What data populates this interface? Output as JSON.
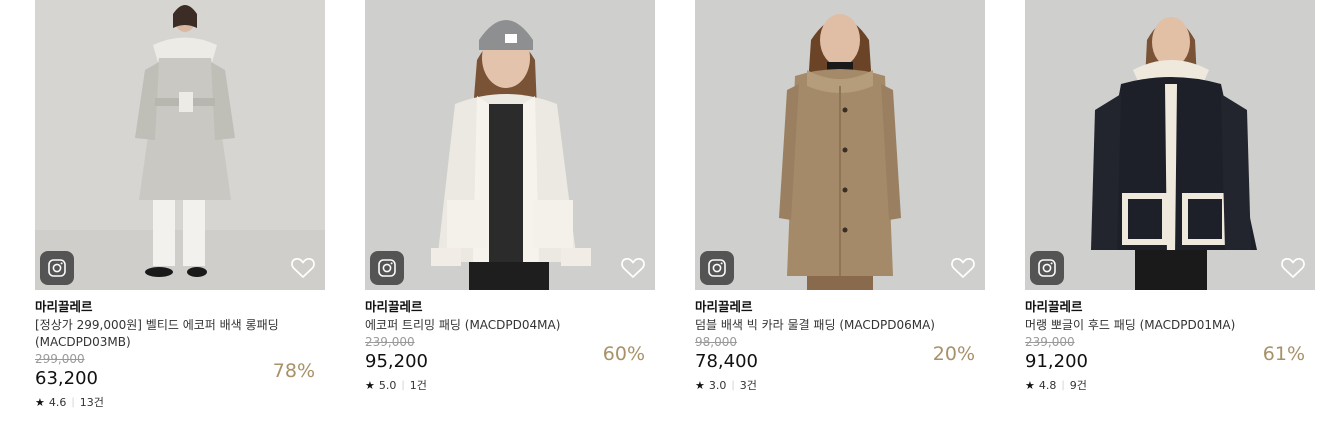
{
  "products": [
    {
      "brand": "마리끌레르",
      "name": "[정상가 299,000원] 벨티드 에코퍼 배색 롱패딩 (MACDPD03MB)",
      "original_price": "299,000",
      "price": "63,200",
      "discount": "78%",
      "rating": "4.6",
      "reviews": "13건",
      "star": "★",
      "garment_color": "#c9c8c2",
      "bg_color": "#d6d5d1"
    },
    {
      "brand": "마리끌레르",
      "name": "에코퍼 트리밍 패딩 (MACDPD04MA)",
      "original_price": "239,000",
      "price": "95,200",
      "discount": "60%",
      "rating": "5.0",
      "reviews": "1건",
      "star": "★",
      "garment_color": "#ece9e2",
      "bg_color": "#cfcfcd"
    },
    {
      "brand": "마리끌레르",
      "name": "덤블 배색 빅 카라 물결 패딩 (MACDPD06MA)",
      "original_price": "98,000",
      "price": "78,400",
      "discount": "20%",
      "rating": "3.0",
      "reviews": "3건",
      "star": "★",
      "garment_color": "#a48a68",
      "bg_color": "#cfcfcd"
    },
    {
      "brand": "마리끌레르",
      "name": "머랭 뽀글이 후드 패딩 (MACDPD01MA)",
      "original_price": "239,000",
      "price": "91,200",
      "discount": "61%",
      "rating": "4.8",
      "reviews": "9건",
      "star": "★",
      "garment_color": "#1d2029",
      "bg_color": "#cfcfcd"
    }
  ],
  "icons": {
    "instagram": "instagram-icon",
    "wishlist": "heart-outline-icon"
  },
  "colors": {
    "discount": "#a89168",
    "original_price": "#9a9a9a",
    "badge_bg": "#4a4a4a"
  }
}
